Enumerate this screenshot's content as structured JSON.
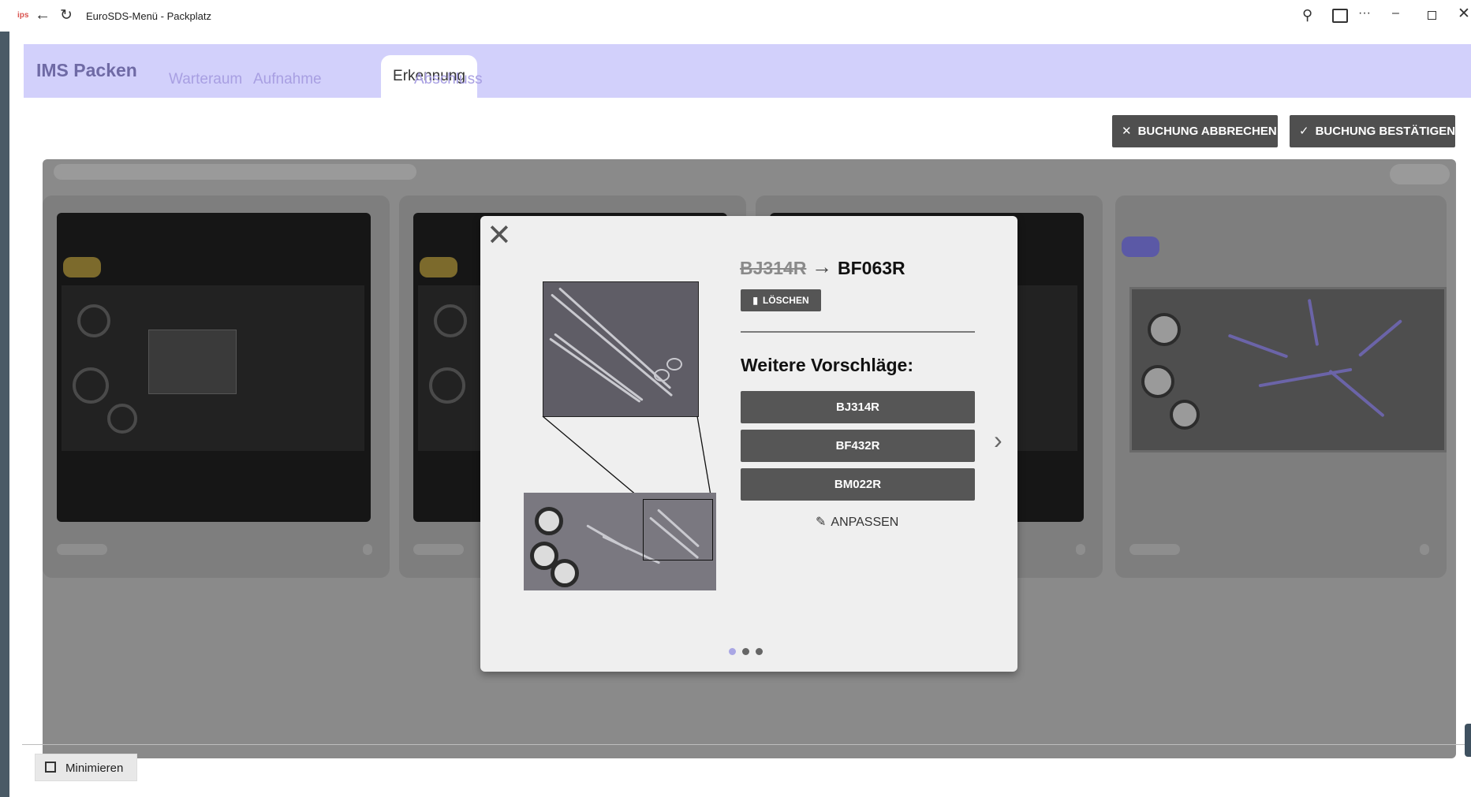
{
  "browser": {
    "logo_text": "ips",
    "title": "EuroSDS-Menü - Packplatz"
  },
  "header": {
    "brand": "IMS Packen",
    "tabs": [
      "Warteraum",
      "Aufnahme",
      "Erkennung",
      "Abschluss"
    ],
    "active_tab": "Erkennung"
  },
  "actions": {
    "cancel_label": "BUCHUNG ABBRECHEN",
    "confirm_label": "BUCHUNG BESTÄTIGEN"
  },
  "modal": {
    "old_code": "BJ314R",
    "new_code": "BF063R",
    "delete_label": "LÖSCHEN",
    "suggestions_title": "Weitere Vorschläge:",
    "suggestions": [
      "BJ314R",
      "BF432R",
      "BM022R"
    ],
    "adjust_label": "ANPASSEN",
    "pagination": {
      "current": 1,
      "total": 3
    }
  },
  "footer": {
    "minimize_label": "Minimieren"
  },
  "colors": {
    "header_bg": "#d2d0fb",
    "brand": "#6f6aa5",
    "inactive_tab": "#a89fe2",
    "button_dark": "#4f4f4f"
  },
  "icons": [
    "back-icon",
    "reload-icon",
    "key-icon",
    "cast-icon",
    "more-icon",
    "minimize-window-icon",
    "restore-window-icon",
    "close-window-icon",
    "close-icon",
    "check-icon",
    "close-x-icon",
    "trash-icon",
    "pencil-icon",
    "chevron-right-icon",
    "minimize-box-icon"
  ]
}
